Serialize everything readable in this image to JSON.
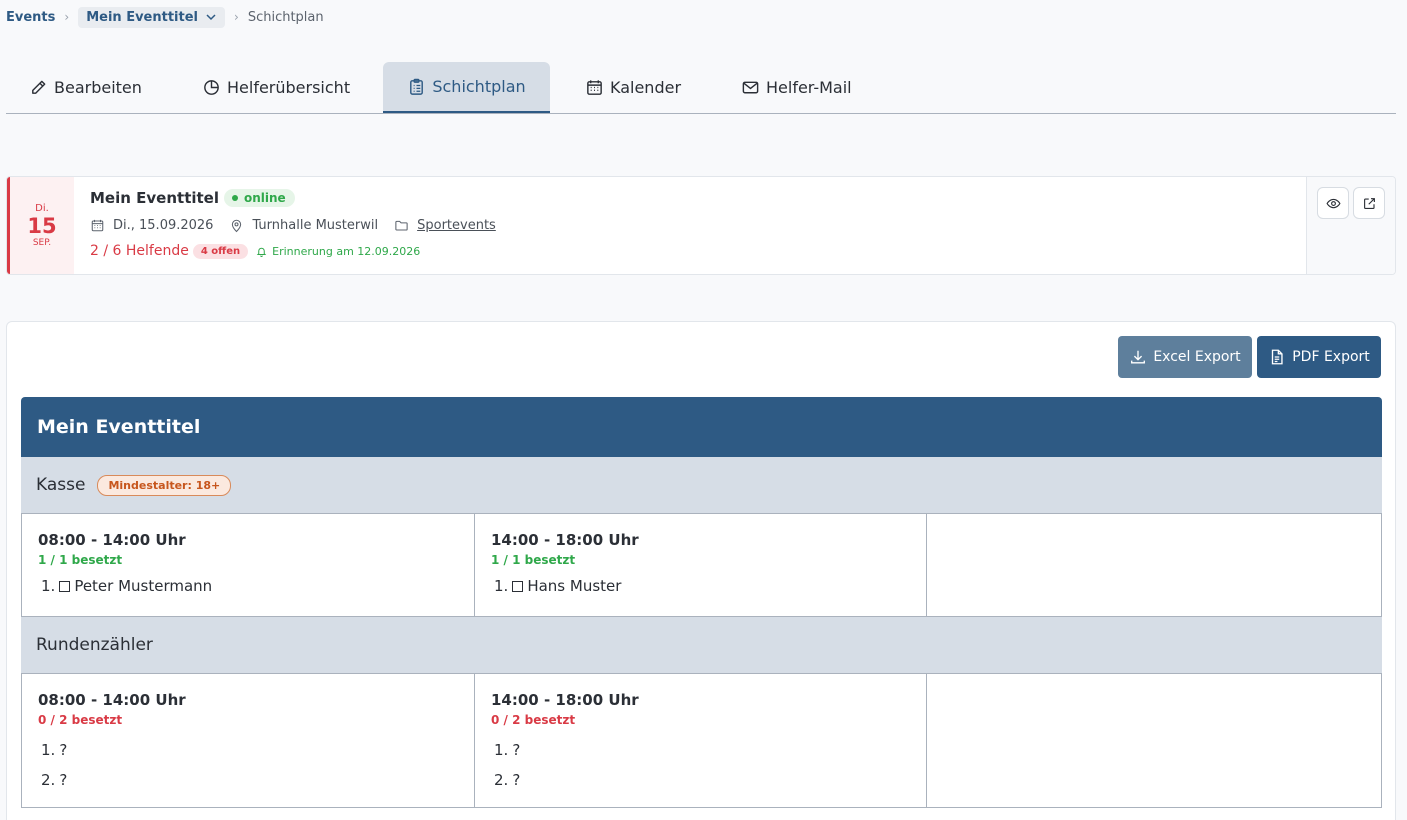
{
  "breadcrumb": {
    "events": "Events",
    "event": "Mein Eventtitel",
    "current": "Schichtplan"
  },
  "tabs": [
    {
      "label": "Bearbeiten",
      "icon": "pencil-icon",
      "active": false
    },
    {
      "label": "Helferübersicht",
      "icon": "pie-chart-icon",
      "active": false
    },
    {
      "label": "Schichtplan",
      "icon": "clipboard-list-icon",
      "active": true
    },
    {
      "label": "Kalender",
      "icon": "calendar-icon",
      "active": false
    },
    {
      "label": "Helfer-Mail",
      "icon": "mail-icon",
      "active": false
    }
  ],
  "event": {
    "dow": "Di.",
    "day": "15",
    "month": "SEP.",
    "title": "Mein Eventtitel",
    "status": "online",
    "date": "Di., 15.09.2026",
    "location": "Turnhalle Musterwil",
    "category": "Sportevents",
    "helpers": "2 / 6 Helfende",
    "open": "4 offen",
    "reminder": "Erinnerung am 12.09.2026"
  },
  "actions": {
    "excel": "Excel Export",
    "pdf": "PDF Export"
  },
  "schedule": {
    "title": "Mein Eventtitel",
    "groups": [
      {
        "name": "Kasse",
        "badge": "Mindestalter: 18+",
        "shifts": [
          {
            "time": "08:00 - 14:00 Uhr",
            "occupancy": "1 / 1 besetzt",
            "slots": [
              {
                "num": "1.",
                "name": "Peter Mustermann"
              }
            ]
          },
          {
            "time": "14:00 - 18:00 Uhr",
            "occupancy": "1 / 1 besetzt",
            "slots": [
              {
                "num": "1.",
                "name": "Hans Muster"
              }
            ]
          }
        ]
      },
      {
        "name": "Rundenzähler",
        "shifts": [
          {
            "time": "08:00 - 14:00 Uhr",
            "occupancy": "0 / 2 besetzt",
            "slots": [
              {
                "num": "1.",
                "name": "?"
              },
              {
                "num": "2.",
                "name": "?"
              }
            ]
          },
          {
            "time": "14:00 - 18:00 Uhr",
            "occupancy": "0 / 2 besetzt",
            "slots": [
              {
                "num": "1.",
                "name": "?"
              },
              {
                "num": "2.",
                "name": "?"
              }
            ]
          }
        ]
      }
    ]
  },
  "colors": {
    "primary": "#2e5a84",
    "danger": "#d93a45",
    "success": "#2fa84a",
    "warning": "#c7561d"
  }
}
